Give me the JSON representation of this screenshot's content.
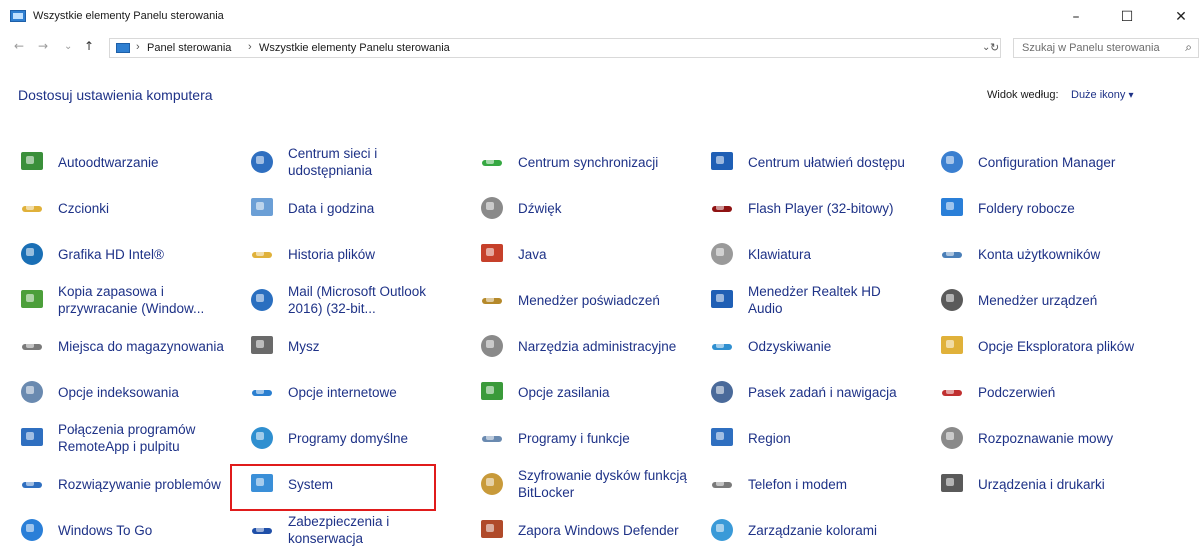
{
  "window": {
    "title": "Wszystkie elementy Panelu sterowania"
  },
  "window_controls": {
    "minimize": "–",
    "maximize": "☐",
    "close": "✕"
  },
  "nav": {
    "back": "←",
    "forward": "→",
    "dropdown": "⌄",
    "up": "↑",
    "refresh_dropdown": "⌄",
    "refresh": "↻"
  },
  "breadcrumbs": [
    "Panel sterowania",
    "Wszystkie elementy Panelu sterowania"
  ],
  "breadcrumb_separator": "›",
  "search": {
    "placeholder": "Szukaj w Panelu sterowania",
    "icon": "search-icon"
  },
  "main": {
    "heading": "Dostosuj ustawienia komputera",
    "view_by_label": "Widok według:",
    "view_by_value": "Duże ikony",
    "view_by_arrow": "▾"
  },
  "items": [
    {
      "label": "Autoodtwarzanie",
      "icon": "autoplay-icon",
      "color": "#3a8f3a"
    },
    {
      "label": "Centrum sieci i udostępniania",
      "icon": "network-icon",
      "color": "#2f6fc0"
    },
    {
      "label": "Centrum synchronizacji",
      "icon": "sync-icon",
      "color": "#36a842"
    },
    {
      "label": "Centrum ułatwień dostępu",
      "icon": "accessibility-icon",
      "color": "#1f5fb5"
    },
    {
      "label": "Configuration Manager",
      "icon": "configuration-manager-icon",
      "color": "#3a7fd0"
    },
    {
      "label": "Czcionki",
      "icon": "fonts-icon",
      "color": "#e0b13a"
    },
    {
      "label": "Data i godzina",
      "icon": "date-time-icon",
      "color": "#6b9fd6"
    },
    {
      "label": "Dźwięk",
      "icon": "speaker-icon",
      "color": "#8a8a8a"
    },
    {
      "label": "Flash Player (32-bitowy)",
      "icon": "flash-player-icon",
      "color": "#8f1313"
    },
    {
      "label": "Foldery robocze",
      "icon": "work-folders-icon",
      "color": "#2a7fd8"
    },
    {
      "label": "Grafika HD Intel®",
      "icon": "intel-graphics-icon",
      "color": "#1a6fb5"
    },
    {
      "label": "Historia plików",
      "icon": "file-history-icon",
      "color": "#e0b13a"
    },
    {
      "label": "Java",
      "icon": "java-icon",
      "color": "#c6402a"
    },
    {
      "label": "Klawiatura",
      "icon": "keyboard-icon",
      "color": "#9a9a9a"
    },
    {
      "label": "Konta użytkowników",
      "icon": "user-accounts-icon",
      "color": "#4a7fb8"
    },
    {
      "label": "Kopia zapasowa i przywracanie (Window...",
      "icon": "backup-icon",
      "color": "#4c9f3a"
    },
    {
      "label": "Mail (Microsoft Outlook 2016) (32-bit...",
      "icon": "mail-icon",
      "color": "#2a6fc0"
    },
    {
      "label": "Menedżer poświadczeń",
      "icon": "credential-manager-icon",
      "color": "#b5892a"
    },
    {
      "label": "Menedżer Realtek HD Audio",
      "icon": "realtek-audio-icon",
      "color": "#1f5fb5"
    },
    {
      "label": "Menedżer urządzeń",
      "icon": "device-manager-icon",
      "color": "#5a5a5a"
    },
    {
      "label": "Miejsca do magazynowania",
      "icon": "storage-spaces-icon",
      "color": "#7a7a7a"
    },
    {
      "label": "Mysz",
      "icon": "mouse-icon",
      "color": "#6a6a6a"
    },
    {
      "label": "Narzędzia administracyjne",
      "icon": "admin-tools-icon",
      "color": "#8a8a8a"
    },
    {
      "label": "Odzyskiwanie",
      "icon": "recovery-icon",
      "color": "#2f8fd0"
    },
    {
      "label": "Opcje Eksploratora plików",
      "icon": "explorer-options-icon",
      "color": "#e0b13a"
    },
    {
      "label": "Opcje indeksowania",
      "icon": "indexing-icon",
      "color": "#6a8ab0"
    },
    {
      "label": "Opcje internetowe",
      "icon": "internet-options-icon",
      "color": "#2a7fd0"
    },
    {
      "label": "Opcje zasilania",
      "icon": "power-options-icon",
      "color": "#3a9a3a"
    },
    {
      "label": "Pasek zadań i nawigacja",
      "icon": "taskbar-icon",
      "color": "#4a6a9a"
    },
    {
      "label": "Podczerwień",
      "icon": "infrared-icon",
      "color": "#c03030"
    },
    {
      "label": "Połączenia programów RemoteApp i pulpitu",
      "icon": "remoteapp-icon",
      "color": "#2f6fc0"
    },
    {
      "label": "Programy domyślne",
      "icon": "default-programs-icon",
      "color": "#2f8fd0"
    },
    {
      "label": "Programy i funkcje",
      "icon": "programs-features-icon",
      "color": "#6a8ab0"
    },
    {
      "label": "Region",
      "icon": "region-icon",
      "color": "#2f6fc0"
    },
    {
      "label": "Rozpoznawanie mowy",
      "icon": "microphone-icon",
      "color": "#8a8a8a"
    },
    {
      "label": "Rozwiązywanie problemów",
      "icon": "troubleshooting-icon",
      "color": "#2f6fc0"
    },
    {
      "label": "System",
      "icon": "system-icon",
      "color": "#3a8fd8"
    },
    {
      "label": "Szyfrowanie dysków funkcją BitLocker",
      "icon": "bitlocker-icon",
      "color": "#c89a3a"
    },
    {
      "label": "Telefon i modem",
      "icon": "phone-modem-icon",
      "color": "#7a7a7a"
    },
    {
      "label": "Urządzenia i drukarki",
      "icon": "devices-printers-icon",
      "color": "#5a5a5a"
    },
    {
      "label": "Windows To Go",
      "icon": "windows-to-go-icon",
      "color": "#2a7fd8"
    },
    {
      "label": "Zabezpieczenia i konserwacja",
      "icon": "security-maintenance-icon",
      "color": "#1f4fa8"
    },
    {
      "label": "Zapora Windows Defender",
      "icon": "firewall-icon",
      "color": "#b04a2a"
    },
    {
      "label": "Zarządzanie kolorami",
      "icon": "color-management-icon",
      "color": "#3a9ad8"
    }
  ],
  "highlighted_item": "System",
  "highlight_color": "#e01b1b",
  "link_color": "#1e3287"
}
